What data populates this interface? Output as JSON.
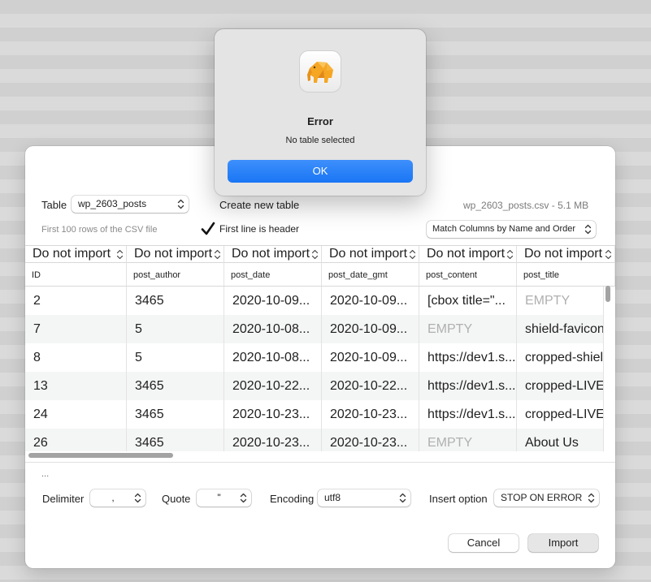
{
  "sheet": {
    "table_label": "Table",
    "table_value": "wp_2603_posts",
    "create_new_table": "Create new table",
    "file_info": "wp_2603_posts.csv -  5.1 MB",
    "preview_hint": "First 100 rows of the CSV file",
    "first_line_header": "First line is header",
    "first_line_header_checked": true,
    "match_columns": "Match Columns by Name and Order",
    "mapping": [
      "Do not import",
      "Do not import",
      "Do not import",
      "Do not import",
      "Do not import",
      "Do not import"
    ],
    "headers": [
      "ID",
      "post_author",
      "post_date",
      "post_date_gmt",
      "post_content",
      "post_title"
    ],
    "rows": [
      [
        "2",
        "3465",
        "2020-10-09...",
        "2020-10-09...",
        "[cbox title=\"...",
        "EMPTY"
      ],
      [
        "7",
        "5",
        "2020-10-08...",
        "2020-10-09...",
        "EMPTY",
        "shield-favicon"
      ],
      [
        "8",
        "5",
        "2020-10-08...",
        "2020-10-09...",
        "https://dev1.s...",
        "cropped-shiel"
      ],
      [
        "13",
        "3465",
        "2020-10-22...",
        "2020-10-22...",
        "https://dev1.s...",
        "cropped-LIVE."
      ],
      [
        "24",
        "3465",
        "2020-10-23...",
        "2020-10-23...",
        "https://dev1.s...",
        "cropped-LIVE."
      ],
      [
        "26",
        "3465",
        "2020-10-23...",
        "2020-10-23...",
        "EMPTY",
        "About Us"
      ]
    ],
    "ellipsis": "...",
    "delimiter_label": "Delimiter",
    "delimiter_value": ",",
    "quote_label": "Quote",
    "quote_value": "\"",
    "encoding_label": "Encoding",
    "encoding_value": "utf8",
    "insert_option_label": "Insert option",
    "insert_option_value": "STOP ON ERROR",
    "cancel": "Cancel",
    "import": "Import"
  },
  "alert": {
    "icon": "elephant-app-icon",
    "title": "Error",
    "message": "No table selected",
    "ok": "OK"
  },
  "colors": {
    "accent": "#1a76f5",
    "empty_text": "#b0b0b0",
    "alt_row": "#f4f5f5"
  }
}
